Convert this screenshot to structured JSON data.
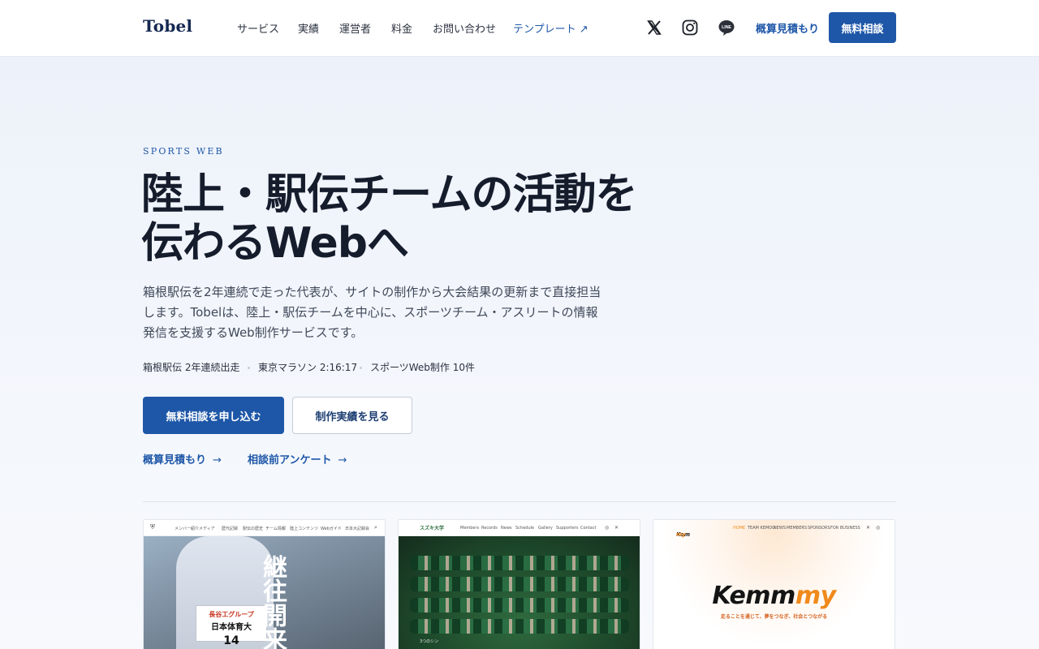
{
  "header": {
    "logo": "Tobel",
    "nav": [
      {
        "label": "サービス"
      },
      {
        "label": "実績"
      },
      {
        "label": "運営者"
      },
      {
        "label": "料金"
      },
      {
        "label": "お問い合わせ"
      },
      {
        "label": "テンプレート ↗"
      }
    ],
    "social_icons": [
      "x-icon",
      "instagram-icon",
      "line-icon"
    ],
    "estimate_link": "概算見積もり",
    "consult_button": "無料相談"
  },
  "hero": {
    "eyebrow": "SPORTS WEB",
    "title_line1": "陸上・駅伝チームの活動を",
    "title_line2": "伝わるWebへ",
    "lead": "箱根駅伝を2年連続で走った代表が、サイトの制作から大会結果の更新まで直接担当します。Tobelは、陸上・駅伝チームを中心に、スポーツチーム・アスリートの情報発信を支援するWeb制作サービスです。",
    "stats": [
      {
        "label": "箱根駅伝 2年連続出走"
      },
      {
        "label": "東京マラソン 2:16:17"
      },
      {
        "label": "スポーツWeb制作 10件"
      }
    ],
    "primary_button": "無料相談を申し込む",
    "secondary_button": "制作実績を見る",
    "links": [
      {
        "label": "概算見積もり",
        "arrow": "→"
      },
      {
        "label": "相談前アンケート",
        "arrow": "→"
      }
    ]
  },
  "works": {
    "card1": {
      "nav": [
        "メンバー紹介",
        "メディア",
        "歴代記録",
        "駅伝の歴史",
        "チーム情報",
        "陸上コンテンツ",
        "Webガイド",
        "日本大記録会"
      ],
      "vertical_text": "継往開来",
      "bib_line1": "日本体育大",
      "bib_line2": "14",
      "bib_top": "長谷工グループ"
    },
    "card2": {
      "nav": [
        "Members",
        "Records",
        "News",
        "Schedule",
        "Gallery",
        "Supporters",
        "Contact"
      ],
      "logo": "スズキ大学",
      "caption": "3つのシン"
    },
    "card3": {
      "nav": [
        "HOME",
        "TEAM KEMOO",
        "NEWS",
        "MEMBERS",
        "SPONSORS",
        "FOR BUSINESS"
      ],
      "mini_logo_a": "Kem",
      "mini_logo_b": "my",
      "brand_a": "Kemm",
      "brand_b": "my",
      "tagline": "走ることを通じて、夢をつなぎ、社会とつながる"
    }
  },
  "colors": {
    "accent": "#1e57a8",
    "title": "#151c2c",
    "hero_bg": "#edf2fa",
    "kemmy_orange": "#f08a1c"
  }
}
